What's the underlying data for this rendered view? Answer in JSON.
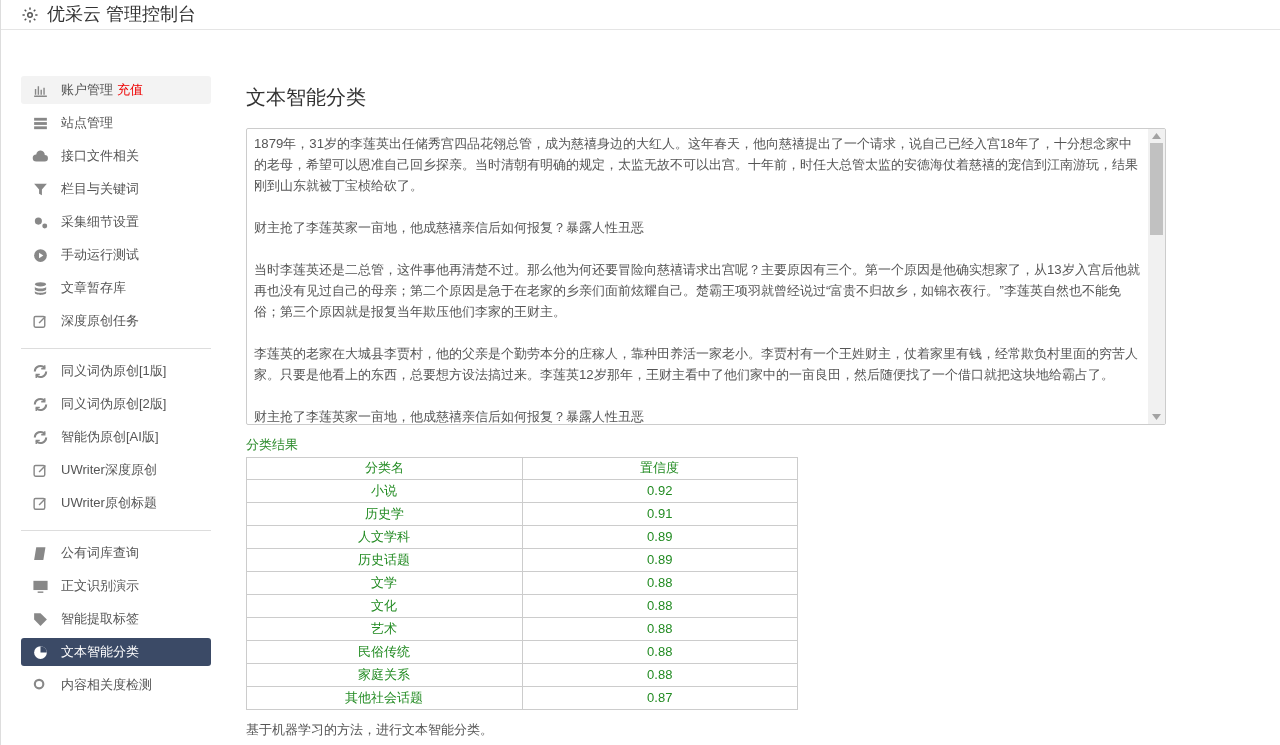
{
  "header": {
    "title": "优采云 管理控制台"
  },
  "sidebar": {
    "groups": [
      [
        {
          "label": "账户管理",
          "badge": "充值",
          "highlighted": true,
          "selected": false
        },
        {
          "label": "站点管理",
          "selected": false
        },
        {
          "label": "接口文件相关",
          "selected": false
        },
        {
          "label": "栏目与关键词",
          "selected": false
        },
        {
          "label": "采集细节设置",
          "selected": false
        },
        {
          "label": "手动运行测试",
          "selected": false
        },
        {
          "label": "文章暂存库",
          "selected": false
        },
        {
          "label": "深度原创任务",
          "selected": false
        }
      ],
      [
        {
          "label": "同义词伪原创[1版]",
          "selected": false
        },
        {
          "label": "同义词伪原创[2版]",
          "selected": false
        },
        {
          "label": "智能伪原创[AI版]",
          "selected": false
        },
        {
          "label": "UWriter深度原创",
          "selected": false
        },
        {
          "label": "UWriter原创标题",
          "selected": false
        }
      ],
      [
        {
          "label": "公有词库查询",
          "selected": false
        },
        {
          "label": "正文识别演示",
          "selected": false
        },
        {
          "label": "智能提取标签",
          "selected": false
        },
        {
          "label": "文本智能分类",
          "selected": true
        },
        {
          "label": "内容相关度检测",
          "selected": false
        }
      ]
    ]
  },
  "main": {
    "title": "文本智能分类",
    "text_input": {
      "paragraphs": [
        "1879年，31岁的李莲英出任储秀宫四品花翎总管，成为慈禧身边的大红人。这年春天，他向慈禧提出了一个请求，说自己已经入宫18年了，十分想念家中的老母，希望可以恩准自己回乡探亲。当时清朝有明确的规定，太监无故不可以出宫。十年前，时任大总管太监的安德海仗着慈禧的宠信到江南游玩，结果刚到山东就被丁宝桢给砍了。",
        "财主抢了李莲英家一亩地，他成慈禧亲信后如何报复？暴露人性丑恶",
        "当时李莲英还是二总管，这件事他再清楚不过。那么他为何还要冒险向慈禧请求出宫呢？主要原因有三个。第一个原因是他确实想家了，从13岁入宫后他就再也没有见过自己的母亲；第二个原因是急于在老家的乡亲们面前炫耀自己。楚霸王项羽就曾经说过“富贵不归故乡，如锦衣夜行。”李莲英自然也不能免俗；第三个原因就是报复当年欺压他们李家的王财主。",
        "李莲英的老家在大城县李贾村，他的父亲是个勤劳本分的庄稼人，靠种田养活一家老小。李贾村有一个王姓财主，仗着家里有钱，经常欺负村里面的穷苦人家。只要是他看上的东西，总要想方设法搞过来。李莲英12岁那年，王财主看中了他们家中的一亩良田，然后随便找了一个借口就把这块地给霸占了。",
        "财主抢了李莲英家一亩地，他成慈禧亲信后如何报复？暴露人性丑恶"
      ]
    },
    "result_label": "分类结果",
    "table": {
      "columns": [
        "分类名",
        "置信度"
      ],
      "rows": [
        [
          "小说",
          "0.92"
        ],
        [
          "历史学",
          "0.91"
        ],
        [
          "人文学科",
          "0.89"
        ],
        [
          "历史话题",
          "0.89"
        ],
        [
          "文学",
          "0.88"
        ],
        [
          "文化",
          "0.88"
        ],
        [
          "艺术",
          "0.88"
        ],
        [
          "民俗传统",
          "0.88"
        ],
        [
          "家庭关系",
          "0.88"
        ],
        [
          "其他社会话题",
          "0.87"
        ]
      ]
    },
    "note": "基于机器学习的方法，进行文本智能分类。"
  }
}
